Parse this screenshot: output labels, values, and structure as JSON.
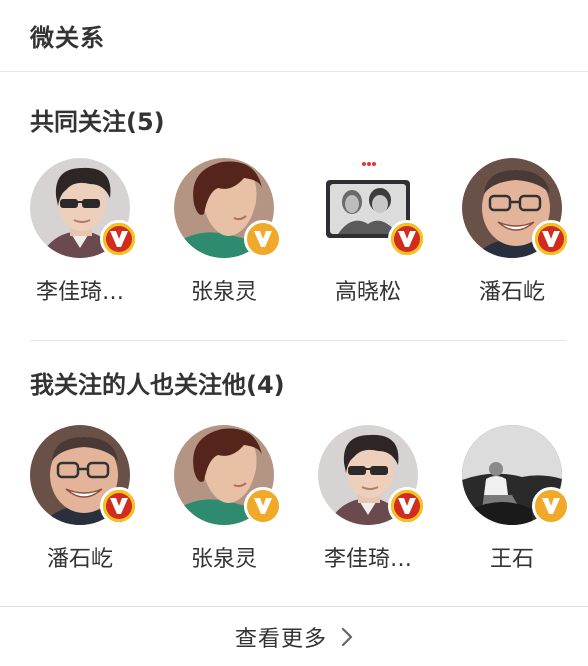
{
  "header": {
    "title": "微关系"
  },
  "sections": [
    {
      "title": "共同关注(5)",
      "people": [
        {
          "name": "李佳琦…",
          "avatar": "young-man-sunglasses-photo",
          "badge": "verified-v-red"
        },
        {
          "name": "张泉灵",
          "avatar": "short-hair-woman-photo",
          "badge": "verified-v-gold"
        },
        {
          "name": "高晓松",
          "avatar": "couple-photo",
          "badge": "verified-v-red"
        },
        {
          "name": "潘石屹",
          "avatar": "smiling-man-glasses-photo",
          "badge": "verified-v-red"
        }
      ]
    },
    {
      "title": "我关注的人也关注他(4)",
      "people": [
        {
          "name": "潘石屹",
          "avatar": "smiling-man-glasses-photo",
          "badge": "verified-v-red"
        },
        {
          "name": "张泉灵",
          "avatar": "short-hair-woman-photo",
          "badge": "verified-v-gold"
        },
        {
          "name": "李佳琦…",
          "avatar": "young-man-sunglasses-photo",
          "badge": "verified-v-red"
        },
        {
          "name": "王石",
          "avatar": "man-outdoor-bw-photo",
          "badge": "verified-v-gold"
        }
      ]
    }
  ],
  "footer": {
    "more_label": "查看更多",
    "icon": "chevron-right-icon"
  },
  "colors": {
    "badge_red": "#d22b1f",
    "badge_ring": "#f4c417",
    "badge_gold": "#f1a92a",
    "text": "#333333",
    "divider": "#e6e6e6"
  }
}
